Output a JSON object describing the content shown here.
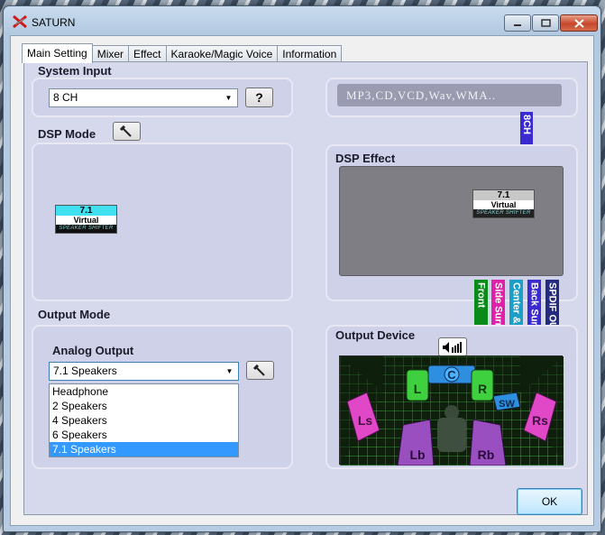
{
  "window": {
    "title": "SATURN"
  },
  "tabs": [
    "Main Setting",
    "Mixer",
    "Effect",
    "Karaoke/Magic Voice",
    "Information"
  ],
  "system_input": {
    "title": "System Input",
    "selected": "8 CH",
    "help_label": "?",
    "formats": "MP3,CD,VCD,Wav,WMA..",
    "channel_tag": "8CH"
  },
  "dsp_mode": {
    "title": "DSP Mode",
    "logo": {
      "number": "7.1",
      "word": "Virtual",
      "sub": "SPEAKER SHIFTER"
    }
  },
  "dsp_effect": {
    "title": "DSP Effect",
    "logo": {
      "number": "7.1",
      "word": "Virtual",
      "sub": "SPEAKER SHIFTER"
    }
  },
  "channel_bars": [
    {
      "label": "Front",
      "color": "#0a8a1a"
    },
    {
      "label": "Side Surround",
      "color": "#e020a8"
    },
    {
      "label": "Center & Sub",
      "color": "#1aa0c8"
    },
    {
      "label": "Back Surround",
      "color": "#3a2ad0"
    },
    {
      "label": "SPDIF OUT",
      "color": "#242a80"
    }
  ],
  "output_mode": {
    "title": "Output Mode",
    "analog_title": "Analog Output",
    "selected": "7.1 Speakers",
    "options": [
      "Headphone",
      "2 Speakers",
      "4 Speakers",
      "6 Speakers",
      "7.1 Speakers"
    ],
    "selected_index": 4
  },
  "output_device": {
    "title": "Output Device",
    "speakers": [
      "C",
      "L",
      "R",
      "SW",
      "Ls",
      "Rs",
      "Lb",
      "Rb"
    ]
  },
  "footer": {
    "ok_label": "OK"
  },
  "colors": {
    "accent": "#3399ff",
    "panel": "#d6d8ec",
    "channel_8ch": "#3a2ad0"
  }
}
